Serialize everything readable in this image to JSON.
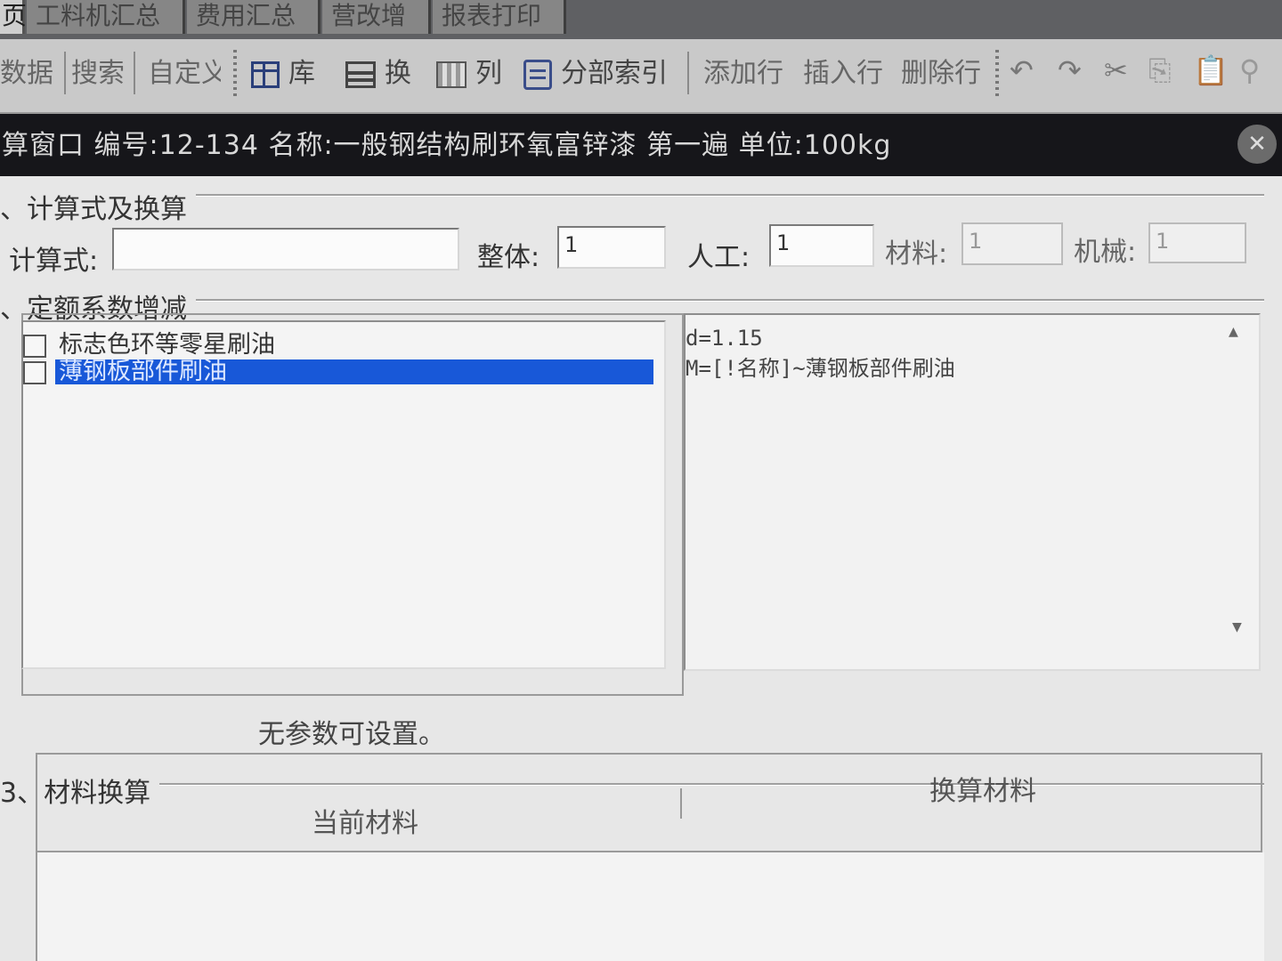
{
  "tabs": [
    {
      "label": "页",
      "active": true
    },
    {
      "label": "工料机汇总",
      "active": false
    },
    {
      "label": "费用汇总",
      "active": false
    },
    {
      "label": "营改增",
      "active": false
    },
    {
      "label": "报表打印",
      "active": false
    }
  ],
  "toolbar": {
    "data": "数据",
    "search": "搜索",
    "custom": "自定义",
    "library": "库",
    "swap": "换",
    "column": "列",
    "section_index": "分部索引",
    "add_row": "添加行",
    "insert_row": "插入行",
    "delete_row": "删除行"
  },
  "window": {
    "title": "算窗口 编号:12-134 名称:一般钢结构刷环氧富锌漆 第一遍 单位:100kg",
    "close_glyph": "✕"
  },
  "section1": {
    "title": "、计算式及换算",
    "formula_label": "计算式:",
    "formula_value": "",
    "whole_label": "整体:",
    "whole_value": "1",
    "labor_label": "人工:",
    "labor_value": "1",
    "material_label": "材料:",
    "material_value": "1",
    "machine_label": "机械:",
    "machine_value": "1"
  },
  "section2": {
    "title": "、定额系数增减",
    "options": [
      {
        "label": "标志色环等零星刷油",
        "selected": false
      },
      {
        "label": "薄钢板部件刷油",
        "selected": true
      }
    ],
    "detail_lines": [
      "d=1.15",
      "M=[!名称]~薄钢板部件刷油"
    ]
  },
  "params_note": "无参数可设置。",
  "section3": {
    "title": "3、材料换算",
    "current_material": "当前材料",
    "swap_material": "换算材料"
  }
}
